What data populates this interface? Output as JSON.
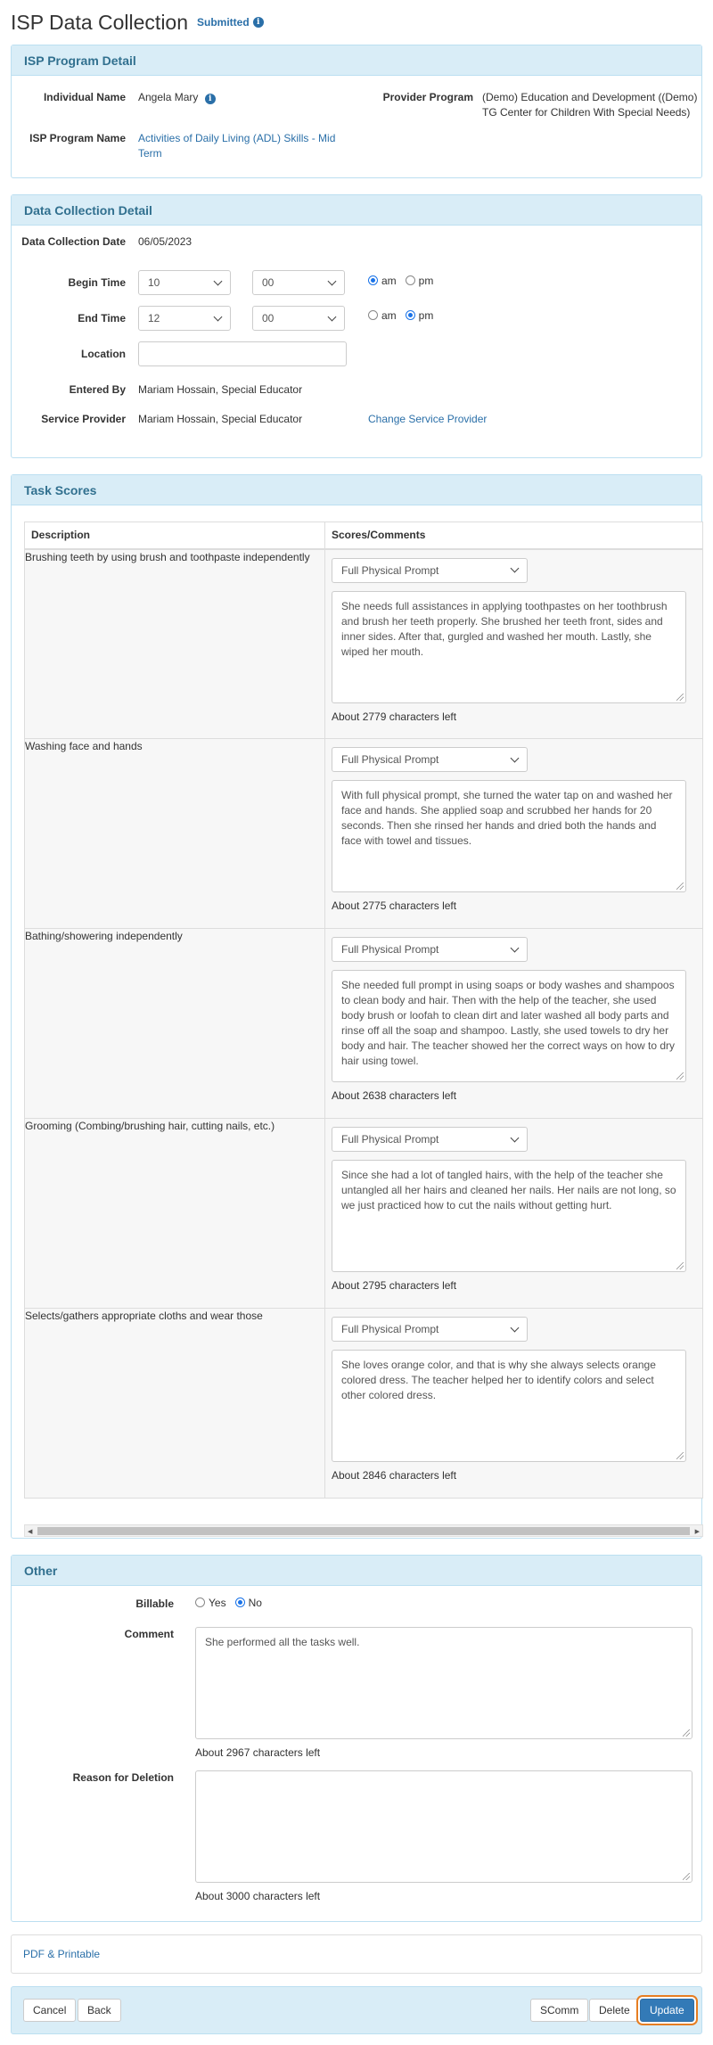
{
  "header": {
    "title": "ISP Data Collection",
    "status": "Submitted"
  },
  "program": {
    "heading": "ISP Program Detail",
    "individual_label": "Individual Name",
    "individual_value": "Angela Mary",
    "provider_label": "Provider Program",
    "provider_value": "(Demo) Education and Development ((Demo) TG Center for Children With Special Needs)",
    "isp_label": "ISP Program Name",
    "isp_value": "Activities of Daily Living (ADL) Skills - Mid Term"
  },
  "collection": {
    "heading": "Data Collection Detail",
    "date_label": "Data Collection Date",
    "date_value": "06/05/2023",
    "begin_label": "Begin Time",
    "begin_hour": "10",
    "begin_minute": "00",
    "end_label": "End Time",
    "end_hour": "12",
    "end_minute": "00",
    "am_label": "am",
    "pm_label": "pm",
    "begin_meridiem": "am",
    "end_meridiem": "pm",
    "location_label": "Location",
    "location_value": "",
    "entered_label": "Entered By",
    "entered_value": "Mariam Hossain, Special Educator",
    "provider_label": "Service Provider",
    "provider_value": "Mariam Hossain, Special Educator",
    "change_provider_link": "Change Service Provider"
  },
  "tasks": {
    "heading": "Task Scores",
    "col_description": "Description",
    "col_scores": "Scores/Comments",
    "rows": [
      {
        "description": "Brushing teeth by using brush and toothpaste independently",
        "score": "Full Physical Prompt",
        "comment": "She needs full assistances in applying toothpastes on her toothbrush and brush her teeth properly. She brushed her teeth front, sides and inner sides. After that, gurgled and washed her mouth. Lastly, she wiped her mouth.",
        "chars_left": "About 2779 characters left"
      },
      {
        "description": "Washing face and hands",
        "score": "Full Physical Prompt",
        "comment": "With full physical prompt, she turned the water tap on and washed her face and hands. She applied soap and scrubbed her hands for 20 seconds. Then she rinsed her hands and dried both the hands and face with towel and tissues.",
        "chars_left": "About 2775 characters left"
      },
      {
        "description": "Bathing/showering independently",
        "score": "Full Physical Prompt",
        "comment": "She needed full prompt in using soaps or body washes and shampoos to clean body and hair. Then with the help of the teacher, she used body brush or loofah to clean dirt and later washed all body parts and rinse off all the soap and shampoo. Lastly, she used towels to dry her body and hair. The teacher showed her the correct ways on how to dry hair using towel.",
        "chars_left": "About 2638 characters left"
      },
      {
        "description": "Grooming (Combing/brushing hair, cutting nails, etc.)",
        "score": "Full Physical Prompt",
        "comment": "Since she had a lot of tangled hairs, with the help of the teacher she untangled all her hairs and cleaned her nails. Her nails are not long, so we just practiced how to cut the nails without getting hurt.",
        "chars_left": "About 2795 characters left"
      },
      {
        "description": "Selects/gathers appropriate cloths and wear those",
        "score": "Full Physical Prompt",
        "comment": "She loves orange color, and that is why she always selects orange colored dress. The teacher helped her to identify colors and select other colored dress.",
        "chars_left": "About 2846 characters left"
      }
    ]
  },
  "other": {
    "heading": "Other",
    "billable_label": "Billable",
    "yes_label": "Yes",
    "no_label": "No",
    "billable_value": "No",
    "comment_label": "Comment",
    "comment_value": "She performed all the tasks well.",
    "comment_chars": "About 2967 characters left",
    "deletion_label": "Reason for Deletion",
    "deletion_value": "",
    "deletion_chars": "About 3000 characters left"
  },
  "links": {
    "pdf": "PDF & Printable"
  },
  "footer": {
    "cancel": "Cancel",
    "back": "Back",
    "scomm": "SComm",
    "delete": "Delete",
    "update": "Update"
  },
  "colors": {
    "accent": "#337ab7",
    "panel_heading_bg": "#d9edf7",
    "panel_heading_text": "#31708f",
    "focus_ring": "#e67e22"
  }
}
